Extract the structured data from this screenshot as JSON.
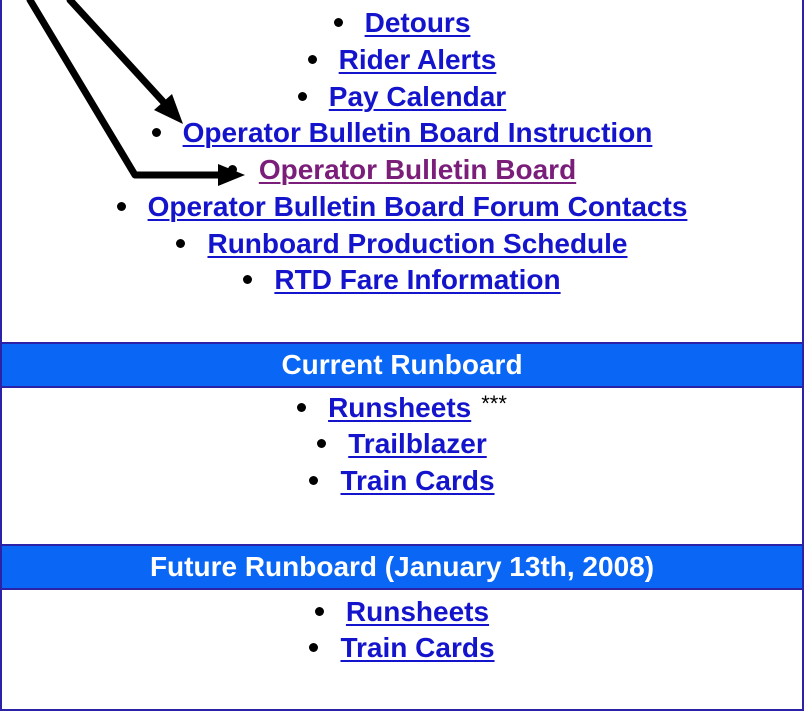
{
  "top_links": [
    {
      "label": "Detours"
    },
    {
      "label": "Rider Alerts"
    },
    {
      "label": "Pay Calendar"
    },
    {
      "label": "Operator Bulletin Board Instruction"
    },
    {
      "label": "Operator Bulletin Board"
    },
    {
      "label": "Operator Bulletin Board Forum Contacts"
    },
    {
      "label": "Runboard Production Schedule"
    },
    {
      "label": "RTD Fare Information"
    }
  ],
  "current_runboard": {
    "title": "Current Runboard",
    "links": [
      {
        "label": "Runsheets",
        "suffix": "***"
      },
      {
        "label": "Trailblazer"
      },
      {
        "label": "Train Cards"
      }
    ]
  },
  "future_runboard": {
    "title": "Future Runboard (January 13th, 2008)",
    "links": [
      {
        "label": "Runsheets"
      },
      {
        "label": "Train Cards"
      }
    ]
  },
  "colors": {
    "link": "#1414cc",
    "visited_link": "#7a1e7a",
    "header_bg": "#0a66f5",
    "border": "#2b22a8"
  }
}
